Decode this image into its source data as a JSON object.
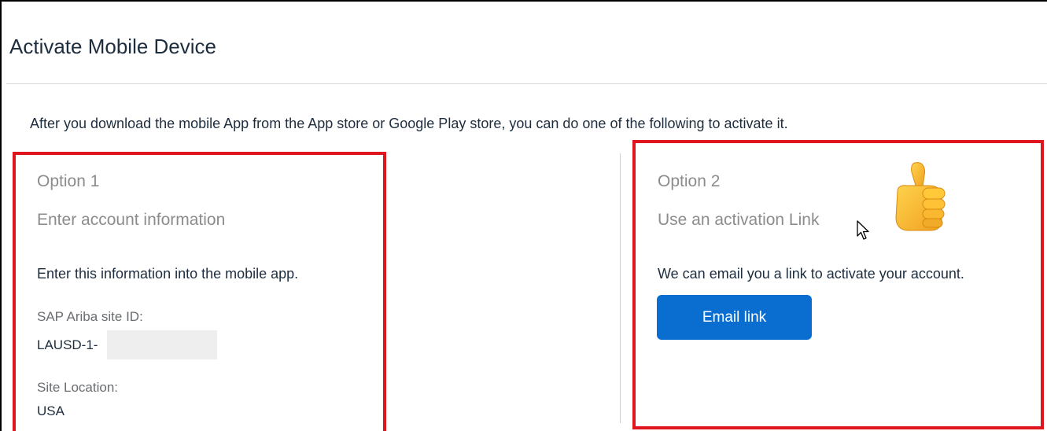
{
  "page": {
    "title": "Activate Mobile Device",
    "intro": "After you download the mobile App from the App store or Google Play store, you can do one of the following to activate it."
  },
  "option1": {
    "number": "Option 1",
    "heading": "Enter account information",
    "instruction": "Enter this information into the mobile app.",
    "site_id_label": "SAP Ariba site ID:",
    "site_id_value": "LAUSD-1-",
    "site_location_label": "Site Location:",
    "site_location_value": "USA"
  },
  "option2": {
    "number": "Option 2",
    "heading": "Use an activation Link",
    "description": "We can email you a link to activate your account.",
    "button_label": "Email link"
  },
  "icons": {
    "cursor": "mouse-cursor-icon",
    "thumbs_up": "thumbs-up-emoji-icon"
  },
  "colors": {
    "highlight_border": "#e0161f",
    "primary_button": "#0a6ed1",
    "muted_heading": "#8c8c8c"
  }
}
